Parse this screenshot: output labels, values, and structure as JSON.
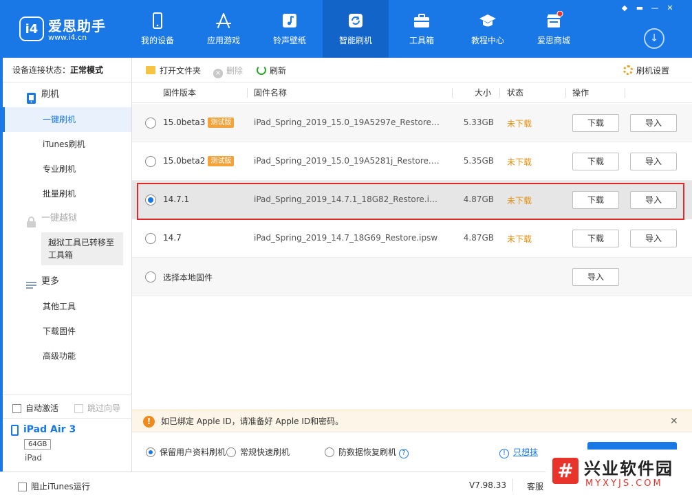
{
  "app": {
    "name": "爱思助手",
    "url": "www.i4.cn",
    "logo_text": "i4"
  },
  "nav": [
    {
      "label": "我的设备",
      "icon": "phone-icon"
    },
    {
      "label": "应用游戏",
      "icon": "app-store-icon"
    },
    {
      "label": "铃声壁纸",
      "icon": "music-icon"
    },
    {
      "label": "智能刷机",
      "icon": "flash-icon",
      "active": true
    },
    {
      "label": "工具箱",
      "icon": "toolbox-icon"
    },
    {
      "label": "教程中心",
      "icon": "graduation-cap-icon"
    },
    {
      "label": "爱思商城",
      "icon": "shop-icon"
    }
  ],
  "window_controls": [
    "◆",
    "▬",
    "—",
    "✕"
  ],
  "sidebar": {
    "status_label": "设备连接状态：",
    "status_value": "正常模式",
    "groups": [
      {
        "label": "刷机",
        "icon": "flash-device-icon",
        "items": [
          "一键刷机",
          "iTunes刷机",
          "专业刷机",
          "批量刷机"
        ]
      },
      {
        "label": "一键越狱",
        "icon": "lock-icon",
        "disabled": true,
        "note": "越狱工具已转移至工具箱"
      },
      {
        "label": "更多",
        "icon": "menu-icon",
        "items": [
          "其他工具",
          "下载固件",
          "高级功能"
        ]
      }
    ],
    "auto_activate": "自动激活",
    "skip_guide": "跳过向导",
    "device": {
      "name": "iPad Air 3",
      "storage": "64GB",
      "type": "iPad"
    }
  },
  "toolbar": {
    "open_folder": "打开文件夹",
    "delete": "删除",
    "refresh": "刷新",
    "settings": "刷机设置"
  },
  "table": {
    "headers": {
      "version": "固件版本",
      "name": "固件名称",
      "size": "大小",
      "status": "状态",
      "actions": "操作"
    },
    "rows": [
      {
        "version": "15.0beta3",
        "tag": "测试版",
        "name": "iPad_Spring_2019_15.0_19A5297e_Restore.ip...",
        "size": "5.33GB",
        "status": "未下载",
        "download": "下载",
        "import": "导入"
      },
      {
        "version": "15.0beta2",
        "tag": "测试版",
        "name": "iPad_Spring_2019_15.0_19A5281j_Restore.ipsw",
        "size": "5.35GB",
        "status": "未下载",
        "download": "下载",
        "import": "导入"
      },
      {
        "version": "14.7.1",
        "tag": "",
        "name": "iPad_Spring_2019_14.7.1_18G82_Restore.ipsw",
        "size": "4.87GB",
        "status": "未下载",
        "download": "下载",
        "import": "导入",
        "selected": true
      },
      {
        "version": "14.7",
        "tag": "",
        "name": "iPad_Spring_2019_14.7_18G69_Restore.ipsw",
        "size": "4.87GB",
        "status": "未下载",
        "download": "下载",
        "import": "导入"
      }
    ],
    "local_firmware": "选择本地固件",
    "local_import": "导入"
  },
  "notice": {
    "text": "如已绑定 Apple ID，请准备好 Apple ID和密码。",
    "close": "✕"
  },
  "flash_options": {
    "keep_data": "保留用户资料刷机",
    "quick": "常规快速刷机",
    "anti_recovery": "防数据恢复刷机",
    "erase_link": "只想抹",
    "help": "?",
    "info": "!"
  },
  "statusbar": {
    "block_itunes": "阻止iTunes运行",
    "version": "V7.98.33",
    "service": "客服"
  },
  "watermark": {
    "logo": "#",
    "title": "兴业软件园",
    "sub": "MYXYJS.COM"
  },
  "colors": {
    "brand": "#1a78e6",
    "status_pending": "#e38e0c",
    "tag": "#f3a33a",
    "highlight": "#e0282a"
  }
}
